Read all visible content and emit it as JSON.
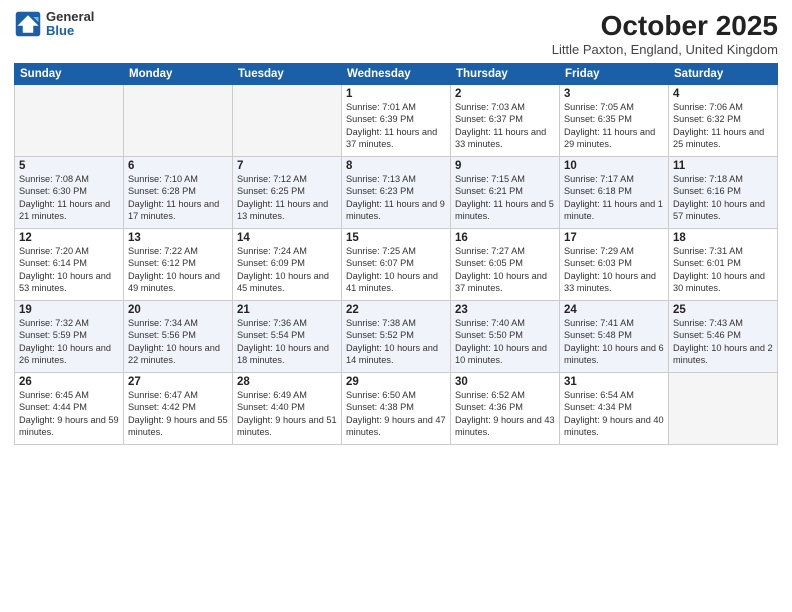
{
  "header": {
    "logo_general": "General",
    "logo_blue": "Blue",
    "title": "October 2025",
    "location": "Little Paxton, England, United Kingdom"
  },
  "days_of_week": [
    "Sunday",
    "Monday",
    "Tuesday",
    "Wednesday",
    "Thursday",
    "Friday",
    "Saturday"
  ],
  "weeks": [
    [
      {
        "day": "",
        "info": ""
      },
      {
        "day": "",
        "info": ""
      },
      {
        "day": "",
        "info": ""
      },
      {
        "day": "1",
        "info": "Sunrise: 7:01 AM\nSunset: 6:39 PM\nDaylight: 11 hours\nand 37 minutes."
      },
      {
        "day": "2",
        "info": "Sunrise: 7:03 AM\nSunset: 6:37 PM\nDaylight: 11 hours\nand 33 minutes."
      },
      {
        "day": "3",
        "info": "Sunrise: 7:05 AM\nSunset: 6:35 PM\nDaylight: 11 hours\nand 29 minutes."
      },
      {
        "day": "4",
        "info": "Sunrise: 7:06 AM\nSunset: 6:32 PM\nDaylight: 11 hours\nand 25 minutes."
      }
    ],
    [
      {
        "day": "5",
        "info": "Sunrise: 7:08 AM\nSunset: 6:30 PM\nDaylight: 11 hours\nand 21 minutes."
      },
      {
        "day": "6",
        "info": "Sunrise: 7:10 AM\nSunset: 6:28 PM\nDaylight: 11 hours\nand 17 minutes."
      },
      {
        "day": "7",
        "info": "Sunrise: 7:12 AM\nSunset: 6:25 PM\nDaylight: 11 hours\nand 13 minutes."
      },
      {
        "day": "8",
        "info": "Sunrise: 7:13 AM\nSunset: 6:23 PM\nDaylight: 11 hours\nand 9 minutes."
      },
      {
        "day": "9",
        "info": "Sunrise: 7:15 AM\nSunset: 6:21 PM\nDaylight: 11 hours\nand 5 minutes."
      },
      {
        "day": "10",
        "info": "Sunrise: 7:17 AM\nSunset: 6:18 PM\nDaylight: 11 hours\nand 1 minute."
      },
      {
        "day": "11",
        "info": "Sunrise: 7:18 AM\nSunset: 6:16 PM\nDaylight: 10 hours\nand 57 minutes."
      }
    ],
    [
      {
        "day": "12",
        "info": "Sunrise: 7:20 AM\nSunset: 6:14 PM\nDaylight: 10 hours\nand 53 minutes."
      },
      {
        "day": "13",
        "info": "Sunrise: 7:22 AM\nSunset: 6:12 PM\nDaylight: 10 hours\nand 49 minutes."
      },
      {
        "day": "14",
        "info": "Sunrise: 7:24 AM\nSunset: 6:09 PM\nDaylight: 10 hours\nand 45 minutes."
      },
      {
        "day": "15",
        "info": "Sunrise: 7:25 AM\nSunset: 6:07 PM\nDaylight: 10 hours\nand 41 minutes."
      },
      {
        "day": "16",
        "info": "Sunrise: 7:27 AM\nSunset: 6:05 PM\nDaylight: 10 hours\nand 37 minutes."
      },
      {
        "day": "17",
        "info": "Sunrise: 7:29 AM\nSunset: 6:03 PM\nDaylight: 10 hours\nand 33 minutes."
      },
      {
        "day": "18",
        "info": "Sunrise: 7:31 AM\nSunset: 6:01 PM\nDaylight: 10 hours\nand 30 minutes."
      }
    ],
    [
      {
        "day": "19",
        "info": "Sunrise: 7:32 AM\nSunset: 5:59 PM\nDaylight: 10 hours\nand 26 minutes."
      },
      {
        "day": "20",
        "info": "Sunrise: 7:34 AM\nSunset: 5:56 PM\nDaylight: 10 hours\nand 22 minutes."
      },
      {
        "day": "21",
        "info": "Sunrise: 7:36 AM\nSunset: 5:54 PM\nDaylight: 10 hours\nand 18 minutes."
      },
      {
        "day": "22",
        "info": "Sunrise: 7:38 AM\nSunset: 5:52 PM\nDaylight: 10 hours\nand 14 minutes."
      },
      {
        "day": "23",
        "info": "Sunrise: 7:40 AM\nSunset: 5:50 PM\nDaylight: 10 hours\nand 10 minutes."
      },
      {
        "day": "24",
        "info": "Sunrise: 7:41 AM\nSunset: 5:48 PM\nDaylight: 10 hours\nand 6 minutes."
      },
      {
        "day": "25",
        "info": "Sunrise: 7:43 AM\nSunset: 5:46 PM\nDaylight: 10 hours\nand 2 minutes."
      }
    ],
    [
      {
        "day": "26",
        "info": "Sunrise: 6:45 AM\nSunset: 4:44 PM\nDaylight: 9 hours\nand 59 minutes."
      },
      {
        "day": "27",
        "info": "Sunrise: 6:47 AM\nSunset: 4:42 PM\nDaylight: 9 hours\nand 55 minutes."
      },
      {
        "day": "28",
        "info": "Sunrise: 6:49 AM\nSunset: 4:40 PM\nDaylight: 9 hours\nand 51 minutes."
      },
      {
        "day": "29",
        "info": "Sunrise: 6:50 AM\nSunset: 4:38 PM\nDaylight: 9 hours\nand 47 minutes."
      },
      {
        "day": "30",
        "info": "Sunrise: 6:52 AM\nSunset: 4:36 PM\nDaylight: 9 hours\nand 43 minutes."
      },
      {
        "day": "31",
        "info": "Sunrise: 6:54 AM\nSunset: 4:34 PM\nDaylight: 9 hours\nand 40 minutes."
      },
      {
        "day": "",
        "info": ""
      }
    ]
  ]
}
